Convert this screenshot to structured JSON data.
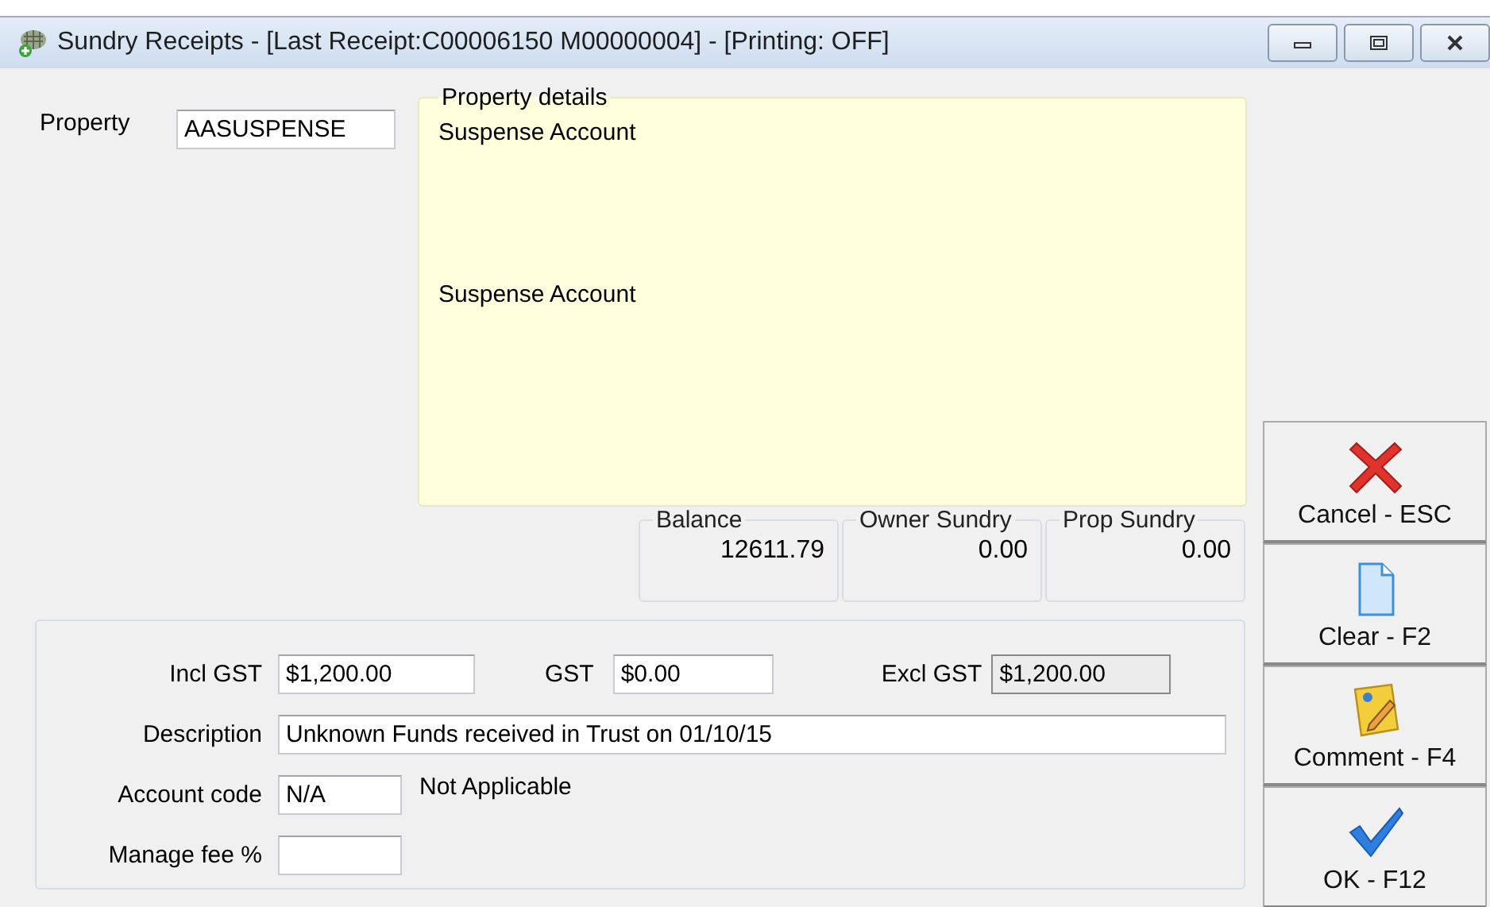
{
  "window": {
    "title": "Sundry Receipts - [Last Receipt:C00006150 M00000004] - [Printing: OFF]"
  },
  "property": {
    "label": "Property",
    "value": "AASUSPENSE"
  },
  "property_details": {
    "legend": "Property details",
    "name": "Suspense Account",
    "address": "Suspense Account"
  },
  "totals": [
    {
      "label": "Balance",
      "value": "12611.79"
    },
    {
      "label": "Owner Sundry",
      "value": "0.00"
    },
    {
      "label": "Prop Sundry",
      "value": "0.00"
    }
  ],
  "form": {
    "incl_gst": {
      "label": "Incl GST",
      "value": "$1,200.00",
      "disabled": false
    },
    "gst": {
      "label": "GST",
      "value": "$0.00",
      "disabled": false
    },
    "excl_gst": {
      "label": "Excl GST",
      "value": "$1,200.00",
      "disabled": true
    },
    "description": {
      "label": "Description",
      "value": "Unknown Funds received in Trust on 01/10/15",
      "disabled": false
    },
    "account_code": {
      "label": "Account code",
      "value": "N/A",
      "note": "Not Applicable",
      "disabled": false
    },
    "manage_fee": {
      "label": "Manage fee %",
      "disabled": false
    }
  },
  "buttons": [
    {
      "label": "Cancel - ESC",
      "kind": "cancel"
    },
    {
      "label": "Clear - F2",
      "kind": "clear"
    },
    {
      "label": "Comment - F4",
      "kind": "comment"
    },
    {
      "label": "OK - F12",
      "kind": "ok"
    }
  ]
}
